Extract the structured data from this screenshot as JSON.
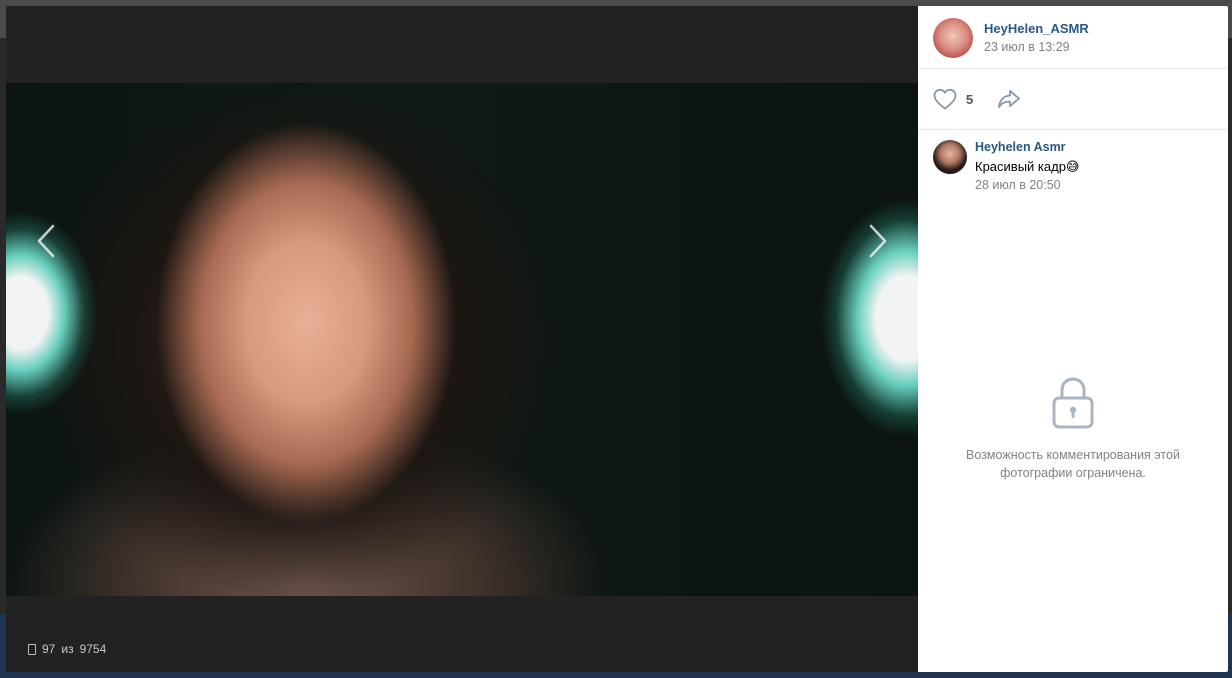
{
  "photo": {
    "counter_current": "97",
    "counter_sep": "из",
    "counter_total": "9754",
    "nav_prev_icon": "chevron-left-icon",
    "nav_next_icon": "chevron-right-icon"
  },
  "author": {
    "name": "HeyHelen_ASMR",
    "date": "23 июл в 13:29"
  },
  "actions": {
    "like_count": "5",
    "like_icon": "heart-icon",
    "share_icon": "share-arrow-icon"
  },
  "comment": {
    "author": "Heyhelen Asmr",
    "text": "Красивый кадр😅",
    "date": "28 июл в 20:50"
  },
  "restricted": {
    "icon": "lock-icon",
    "text": "Возможность комментирования этой фотографии ограничена."
  },
  "colors": {
    "link": "#2a5885",
    "muted": "#828282",
    "viewer_bg": "#222222"
  }
}
